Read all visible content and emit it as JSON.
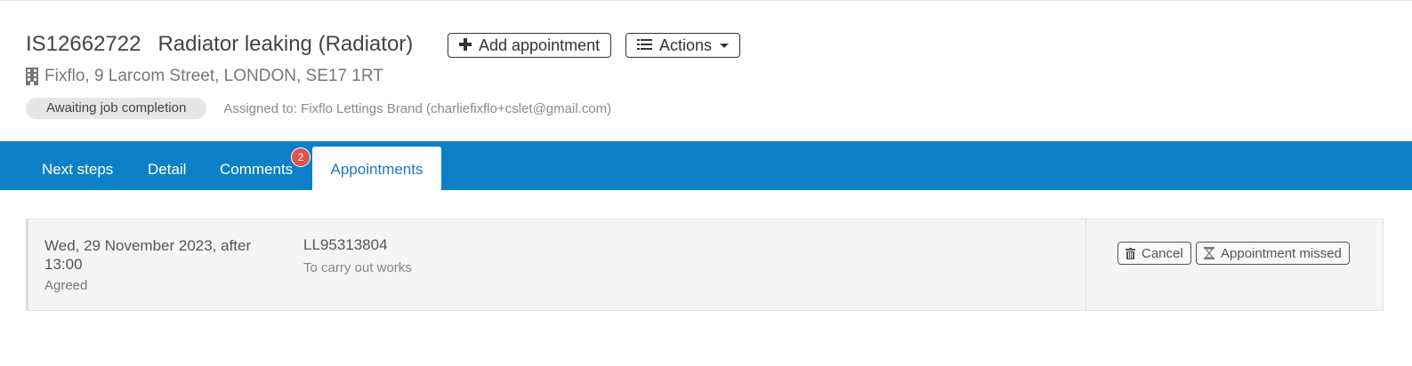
{
  "header": {
    "job_ref": "IS12662722",
    "job_title": "Radiator leaking (Radiator)",
    "add_appointment_label": "Add appointment",
    "actions_label": "Actions",
    "address": "Fixflo, 9 Larcom Street, LONDON, SE17 1RT",
    "status": "Awaiting job completion",
    "assigned": "Assigned to: Fixflo Lettings Brand (charliefixflo+cslet@gmail.com)"
  },
  "tabs": [
    {
      "label": "Next steps",
      "active": false
    },
    {
      "label": "Detail",
      "active": false
    },
    {
      "label": "Comments",
      "active": false,
      "badge": "2"
    },
    {
      "label": "Appointments",
      "active": true
    }
  ],
  "appointment": {
    "date": "Wed, 29 November 2023, after 13:00",
    "status": "Agreed",
    "ref": "LL95313804",
    "purpose": "To carry out works",
    "cancel_label": "Cancel",
    "missed_label": "Appointment missed"
  },
  "colors": {
    "tabbar": "#0c80c6",
    "active_tab_text": "#1d78bf",
    "badge": "#d9534f"
  },
  "icons": {
    "add": "plus-icon",
    "actions": "list-icon",
    "address": "building-icon",
    "cancel": "trash-icon",
    "missed": "hourglass-icon"
  }
}
